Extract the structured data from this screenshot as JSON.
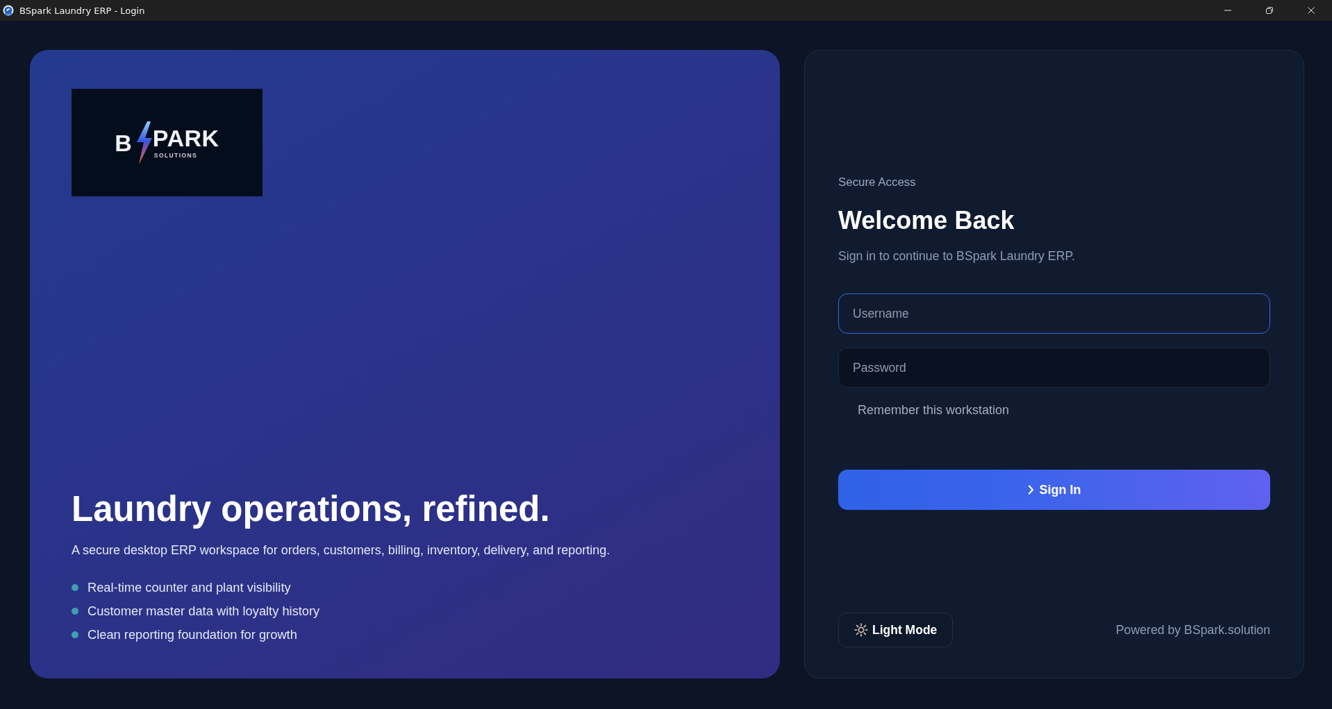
{
  "window": {
    "title": "BSpark Laundry ERP - Login",
    "controls": [
      {
        "kind": "minimize"
      },
      {
        "kind": "restore"
      },
      {
        "kind": "close"
      }
    ]
  },
  "hero": {
    "logo": {
      "letter": "B",
      "word": "PARK",
      "tagline": "SOLUTIONS"
    },
    "headline": "Laundry operations, refined.",
    "description": "A secure desktop ERP workspace for orders, customers, billing, inventory, delivery, and reporting.",
    "features": [
      "Real-time counter and plant visibility",
      "Customer master data with loyalty history",
      "Clean reporting foundation for growth"
    ]
  },
  "login": {
    "eyebrow": "Secure Access",
    "title": "Welcome Back",
    "subtitle": "Sign in to continue to BSpark Laundry ERP.",
    "fields": [
      {
        "placeholder": "Username",
        "focused": true
      },
      {
        "placeholder": "Password",
        "focused": false
      }
    ],
    "remember": {
      "label": "Remember this workstation"
    },
    "submit": {
      "label": "Sign In"
    }
  },
  "footer": {
    "theme_button": {
      "label": "Light Mode"
    },
    "powered_by": "Powered by BSpark.solution"
  }
}
